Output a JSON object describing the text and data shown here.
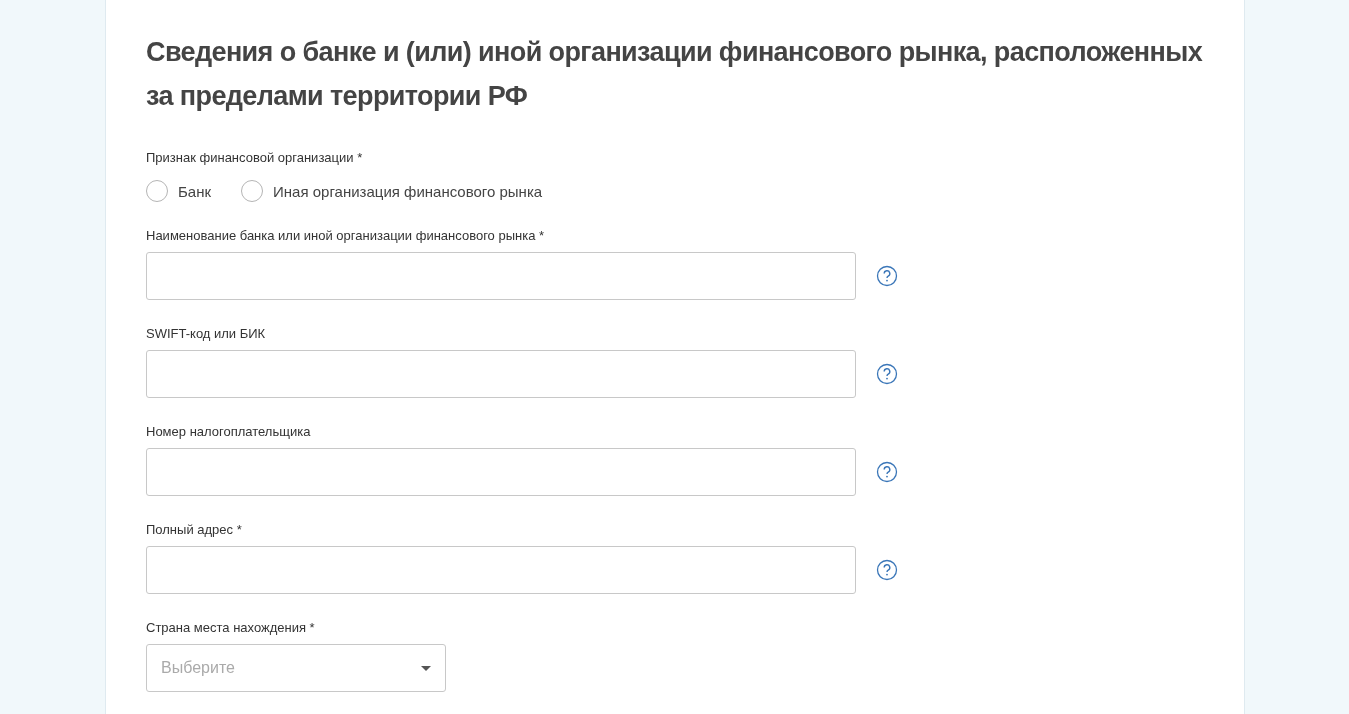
{
  "title": "Сведения о банке и (или) иной организации финансового рынка, расположенных за пределами территории РФ",
  "org_type": {
    "label": "Признак финансовой организации *",
    "options": [
      {
        "label": "Банк",
        "selected": false
      },
      {
        "label": "Иная организация финансового рынка",
        "selected": false
      }
    ]
  },
  "fields": [
    {
      "label": "Наименование банка или иной организации финансового рынка *",
      "has_help": true
    },
    {
      "label": "SWIFT-код или БИК",
      "has_help": true
    },
    {
      "label": "Номер налогоплательщика",
      "has_help": true
    },
    {
      "label": "Полный адрес *",
      "has_help": true
    }
  ],
  "country": {
    "label": "Страна места нахождения *",
    "placeholder": "Выберите"
  }
}
